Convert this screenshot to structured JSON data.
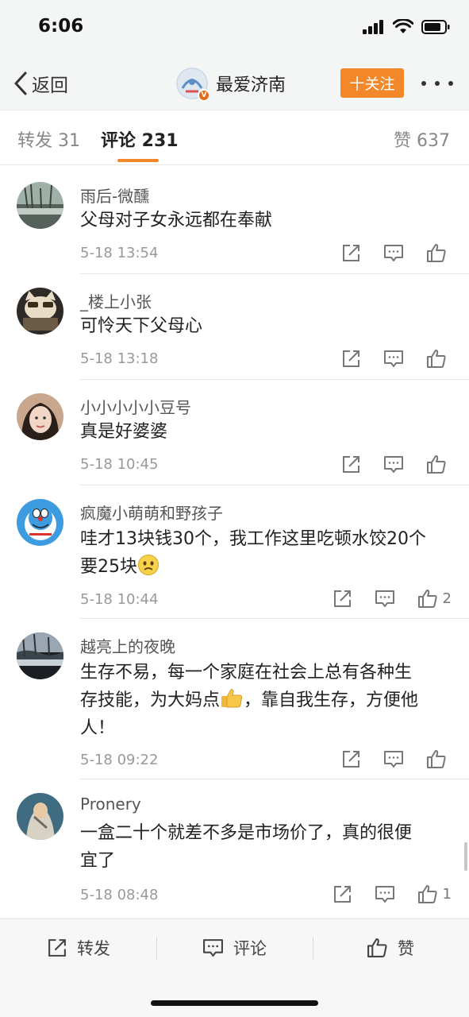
{
  "status": {
    "time": "6:06"
  },
  "nav": {
    "back_label": "返回",
    "title": "最爱济南",
    "follow_label": "十关注",
    "verified_mark": "V"
  },
  "tabs": {
    "repost": "转发 31",
    "comments": "评论 231",
    "likes": "赞 637"
  },
  "comments": [
    {
      "user": "雨后-微醺",
      "text": "父母对子女永远都在奉献",
      "time": "5-18 13:54",
      "likes": ""
    },
    {
      "user": "_楼上小张",
      "text": "可怜天下父母心",
      "time": "5-18 13:18",
      "likes": ""
    },
    {
      "user": "小小小小小豆号",
      "text": "真是好婆婆",
      "time": "5-18 10:45",
      "likes": ""
    },
    {
      "user": "疯魔小萌萌和野孩子",
      "text_line1": "哇才13块钱30个，我工作这里吃顿水饺20个",
      "text_line2": "要25块",
      "time": "5-18 10:44",
      "likes": "2"
    },
    {
      "user": "越亮上的夜晚",
      "text_line1": "生存不易，每一个家庭在社会上总有各种生",
      "text_line2a": "存技能，为大妈点",
      "text_line2b": "，靠自我生存，方便他",
      "text_line3": "人！",
      "time": "5-18 09:22",
      "likes": ""
    },
    {
      "user": "Pronery",
      "text_line1": "一盒二十个就差不多是市场价了，真的很便",
      "text_line2": "宜了",
      "time": "5-18 08:48",
      "likes": "1"
    }
  ],
  "bottom_bar": {
    "repost": "转发",
    "comment": "评论",
    "like": "赞"
  },
  "icons": {
    "back": "chevron-left-icon",
    "more": "more-dots-icon",
    "share": "share-icon",
    "reply": "comment-icon",
    "like": "thumbs-up-icon",
    "sad_emoji": "sad-face-emoji",
    "thumbs_emoji": "thumbs-up-emoji"
  },
  "colors": {
    "accent": "#f3882b",
    "background": "#ffffff",
    "bar_background": "#f4f5f5"
  }
}
